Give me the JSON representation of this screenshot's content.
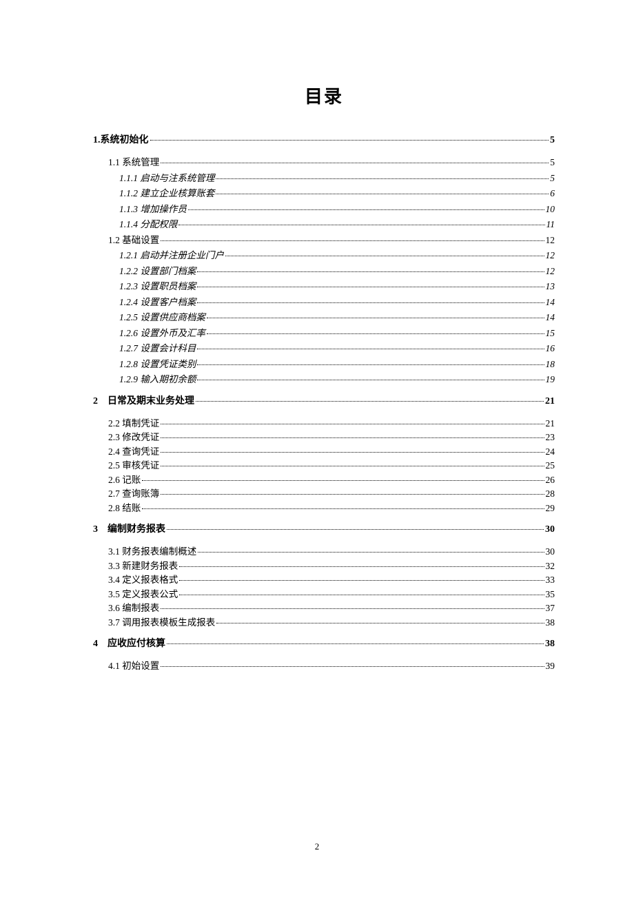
{
  "title": "目录",
  "page_number": "2",
  "entries": [
    {
      "level": 1,
      "label": "1.系统初始化",
      "page": "5"
    },
    {
      "level": 2,
      "label": "1.1 系统管理",
      "page": "5"
    },
    {
      "level": 3,
      "label": "1.1.1 启动与注系统管理",
      "page": "5"
    },
    {
      "level": 3,
      "label": "1.1.2 建立企业核算账套",
      "page": "6"
    },
    {
      "level": 3,
      "label": "1.1.3 增加操作员",
      "page": "10"
    },
    {
      "level": 3,
      "label": "1.1.4 分配权限",
      "page": "11"
    },
    {
      "level": 2,
      "label": "1.2 基础设置",
      "page": "12"
    },
    {
      "level": 3,
      "label": "1.2.1 启动并注册企业门户",
      "page": "12"
    },
    {
      "level": 3,
      "label": "1.2.2 设置部门档案",
      "page": "12"
    },
    {
      "level": 3,
      "label": "1.2.3 设置职员档案",
      "page": "13"
    },
    {
      "level": 3,
      "label": "1.2.4 设置客户档案",
      "page": "14"
    },
    {
      "level": 3,
      "label": "1.2.5 设置供应商档案",
      "page": "14"
    },
    {
      "level": 3,
      "label": "1.2.6 设置外币及汇率",
      "page": "15"
    },
    {
      "level": 3,
      "label": "1.2.7 设置会计科目",
      "page": "16"
    },
    {
      "level": 3,
      "label": "1.2.8 设置凭证类别",
      "page": "18"
    },
    {
      "level": 3,
      "label": "1.2.9 输入期初余额",
      "page": "19"
    },
    {
      "level": 1,
      "label": "2　日常及期末业务处理",
      "page": "21"
    },
    {
      "level": 2,
      "label": "2.2 填制凭证",
      "page": "21"
    },
    {
      "level": 2,
      "label": "2.3 修改凭证",
      "page": "23"
    },
    {
      "level": 2,
      "label": "2.4 查询凭证",
      "page": "24"
    },
    {
      "level": 2,
      "label": "2.5 审核凭证",
      "page": "25"
    },
    {
      "level": 2,
      "label": "2.6 记账",
      "page": "26"
    },
    {
      "level": 2,
      "label": "2.7 查询账簿",
      "page": "28"
    },
    {
      "level": 2,
      "label": "2.8 结账",
      "page": "29"
    },
    {
      "level": 1,
      "label": "3　编制财务报表",
      "page": "30"
    },
    {
      "level": 2,
      "label": "3.1 财务报表编制概述",
      "page": "30"
    },
    {
      "level": 2,
      "label": "3.3 新建财务报表",
      "page": "32"
    },
    {
      "level": 2,
      "label": "3.4 定义报表格式",
      "page": "33"
    },
    {
      "level": 2,
      "label": "3.5 定义报表公式",
      "page": "35"
    },
    {
      "level": 2,
      "label": "3.6 编制报表",
      "page": "37"
    },
    {
      "level": 2,
      "label": "3.7 调用报表模板生成报表",
      "page": "38"
    },
    {
      "level": 1,
      "label": "4　应收应付核算",
      "page": "38"
    },
    {
      "level": 2,
      "label": "4.1 初始设置",
      "page": "39"
    }
  ]
}
